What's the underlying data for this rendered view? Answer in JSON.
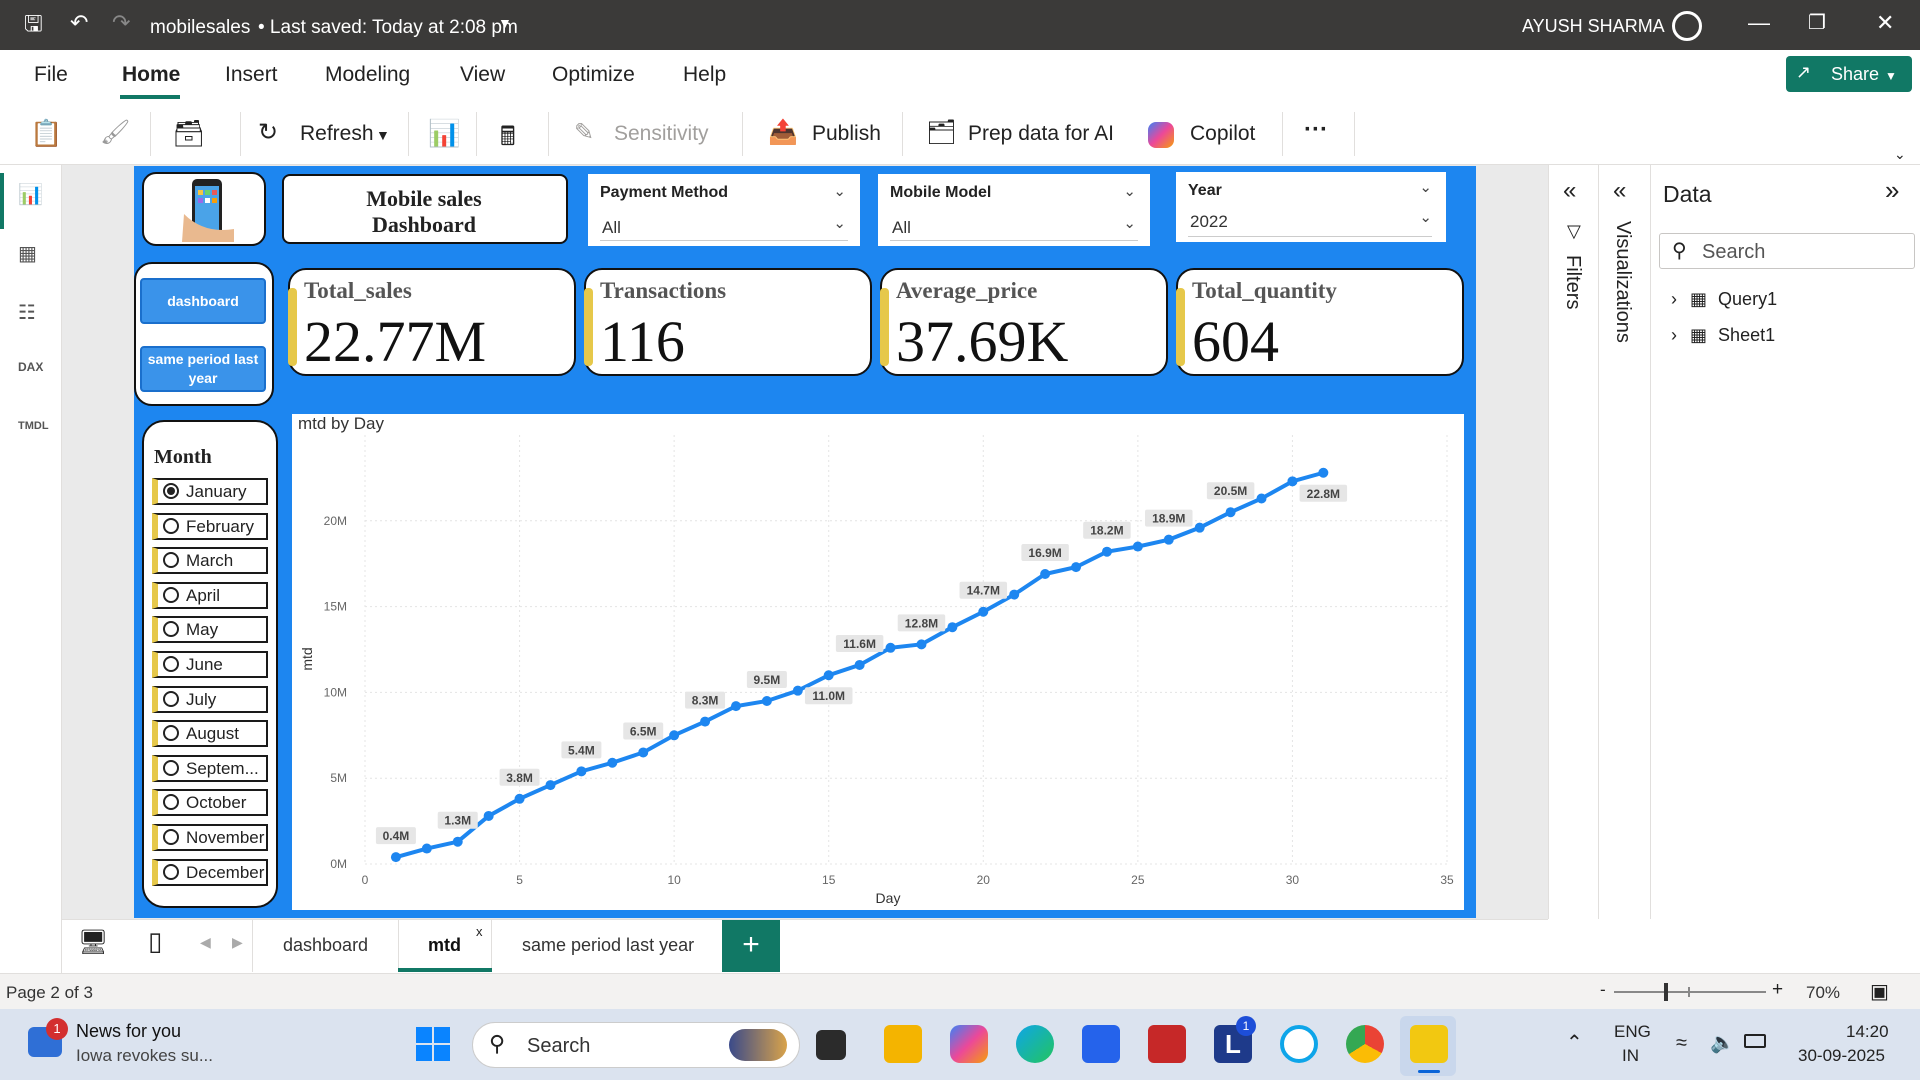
{
  "window": {
    "title": "mobilesales",
    "saved": "• Last saved: Today at 2:08 pm",
    "user": "AYUSH SHARMA"
  },
  "menu": [
    "File",
    "Home",
    "Insert",
    "Modeling",
    "View",
    "Optimize",
    "Help"
  ],
  "share_label": "Share",
  "ribbon": {
    "refresh": "Refresh",
    "sensitivity": "Sensitivity",
    "publish": "Publish",
    "prep": "Prep data for AI",
    "copilot": "Copilot",
    "more": "···"
  },
  "report": {
    "title": "Mobile sales Dashboard",
    "slicers": [
      {
        "title": "Payment Method",
        "value": "All"
      },
      {
        "title": "Mobile Model",
        "value": "All"
      },
      {
        "title": "Year",
        "value": "2022"
      }
    ],
    "nav_buttons": [
      "dashboard",
      "same period last year"
    ],
    "kpis": [
      {
        "label": "Total_sales",
        "value": "22.77M"
      },
      {
        "label": "Transactions",
        "value": "116"
      },
      {
        "label": "Average_price",
        "value": "37.69K"
      },
      {
        "label": "Total_quantity",
        "value": "604"
      }
    ],
    "month_title": "Month",
    "months": [
      "January",
      "February",
      "March",
      "April",
      "May",
      "June",
      "July",
      "August",
      "Septem...",
      "October",
      "November",
      "December"
    ],
    "selected_month": "January"
  },
  "chart_data": {
    "type": "line",
    "title": "mtd by Day",
    "xlabel": "Day",
    "ylabel": "mtd",
    "xlim": [
      0,
      35
    ],
    "ylim": [
      0,
      25
    ],
    "x_ticks": [
      0,
      5,
      10,
      15,
      20,
      25,
      30,
      35
    ],
    "y_ticks": [
      "0M",
      "5M",
      "10M",
      "15M",
      "20M"
    ],
    "color": "#1d86f0",
    "series": [
      {
        "x": [
          1,
          2,
          3,
          4,
          5,
          6,
          7,
          8,
          9,
          10,
          11,
          12,
          13,
          14,
          15,
          16,
          17,
          18,
          19,
          20,
          21,
          22,
          23,
          24,
          25,
          26,
          27,
          28,
          29,
          30,
          31
        ],
        "values": [
          0.4,
          0.9,
          1.3,
          2.8,
          3.8,
          4.6,
          5.4,
          5.9,
          6.5,
          7.5,
          8.3,
          9.2,
          9.5,
          10.1,
          11.0,
          11.6,
          12.6,
          12.8,
          13.8,
          14.7,
          15.7,
          16.9,
          17.3,
          18.2,
          18.5,
          18.9,
          19.6,
          20.5,
          21.3,
          22.3,
          22.8
        ]
      }
    ],
    "data_labels": [
      {
        "x": 1,
        "text": "0.4M"
      },
      {
        "x": 3,
        "text": "1.3M"
      },
      {
        "x": 5,
        "text": "3.8M"
      },
      {
        "x": 7,
        "text": "5.4M"
      },
      {
        "x": 9,
        "text": "6.5M"
      },
      {
        "x": 11,
        "text": "8.3M"
      },
      {
        "x": 13,
        "text": "9.5M"
      },
      {
        "x": 15,
        "text": "11.0M",
        "below": true
      },
      {
        "x": 16,
        "text": "11.6M"
      },
      {
        "x": 18,
        "text": "12.8M"
      },
      {
        "x": 20,
        "text": "14.7M"
      },
      {
        "x": 22,
        "text": "16.9M"
      },
      {
        "x": 24,
        "text": "18.2M"
      },
      {
        "x": 26,
        "text": "18.9M"
      },
      {
        "x": 28,
        "text": "20.5M"
      },
      {
        "x": 31,
        "text": "22.8M",
        "below": true
      }
    ]
  },
  "right_panes": {
    "filters": "Filters",
    "visualizations": "Visualizations",
    "data_title": "Data",
    "search_placeholder": "Search",
    "tables": [
      "Query1",
      "Sheet1"
    ]
  },
  "page_tabs": [
    "dashboard",
    "mtd",
    "same period last year"
  ],
  "active_tab": "mtd",
  "status": {
    "page": "Page 2 of 3",
    "zoom": "70%"
  },
  "taskbar": {
    "news_title": "News for you",
    "news_sub": "Iowa revokes su...",
    "news_badge": "1",
    "search": "Search",
    "lang1": "ENG",
    "lang2": "IN",
    "time": "14:20",
    "date": "30-09-2025",
    "l_badge": "1"
  }
}
